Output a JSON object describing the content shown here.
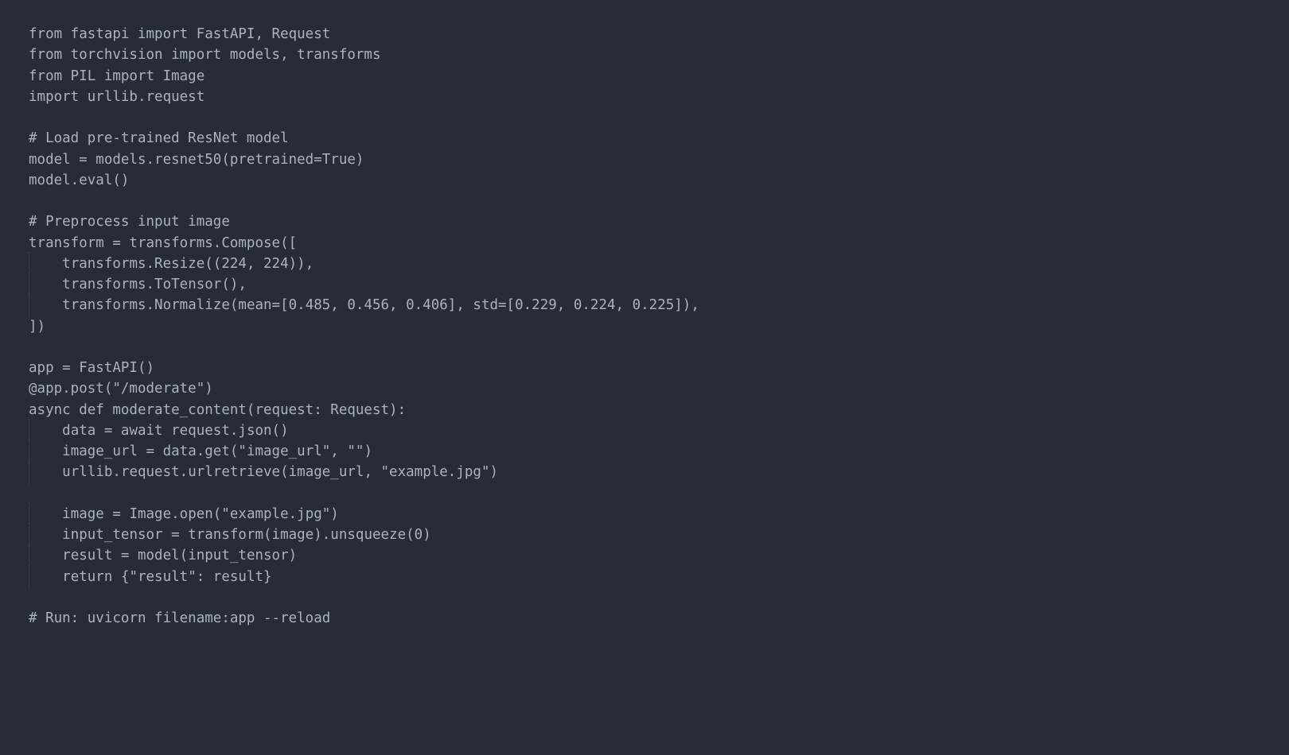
{
  "code": {
    "lines": [
      "from fastapi import FastAPI, Request",
      "from torchvision import models, transforms",
      "from PIL import Image",
      "import urllib.request",
      "",
      "# Load pre-trained ResNet model",
      "model = models.resnet50(pretrained=True)",
      "model.eval()",
      "",
      "# Preprocess input image",
      "transform = transforms.Compose([",
      "    transforms.Resize((224, 224)),",
      "    transforms.ToTensor(),",
      "    transforms.Normalize(mean=[0.485, 0.456, 0.406], std=[0.229, 0.224, 0.225]),",
      "])",
      "",
      "app = FastAPI()",
      "@app.post(\"/moderate\")",
      "async def moderate_content(request: Request):",
      "    data = await request.json()",
      "    image_url = data.get(\"image_url\", \"\")",
      "    urllib.request.urlretrieve(image_url, \"example.jpg\")",
      "",
      "    image = Image.open(\"example.jpg\")",
      "    input_tensor = transform(image).unsqueeze(0)",
      "    result = model(input_tensor)",
      "    return {\"result\": result}",
      "",
      "# Run: uvicorn filename:app --reload"
    ]
  },
  "colors": {
    "background": "#282c34",
    "text": "#abb2bf",
    "indent_guide": "#3e4451"
  },
  "language": "python"
}
